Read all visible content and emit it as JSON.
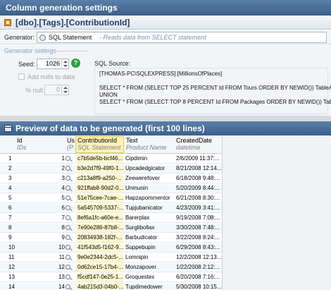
{
  "window_title": "Column generation settings",
  "column_path": "[dbo].[Tags].[ContributionId]",
  "generator": {
    "label": "Generator:",
    "name": "SQL Statement",
    "description": "- Reads data from SELECT statement"
  },
  "settings": {
    "section_title": "Generator settings",
    "seed_label": "Seed:",
    "seed_value": "1026",
    "add_nulls_label": "Add nulls to data",
    "null_pct_label": "% null:",
    "null_pct_value": "0",
    "sql_source_label": "SQL Source:",
    "sql_lines": [
      "[THOMAS-PC\\SQLEXPRESS].[MillionsOfPlaces]",
      "",
      "SELECT * FROM (SELECT TOP 25 PERCENT Id FROM Tours ORDER BY NEWID()) TableA",
      "UNION",
      "SELECT * FROM (SELECT TOP 8 PERCENT Id FROM Packages ORDER BY NEWID()) TableB;"
    ]
  },
  "preview": {
    "title": "Preview of data to be generated (first 100 lines)",
    "columns": [
      {
        "name": "Id",
        "type": "IDs"
      },
      {
        "name": "Us",
        "type": "(P"
      },
      {
        "name": "ContributionId",
        "type": "SQL Statement"
      },
      {
        "name": "Text",
        "type": "Product Name"
      },
      {
        "name": "CreatedDate",
        "type": "datetime"
      }
    ],
    "rows": [
      {
        "rn": "1",
        "id": "1",
        "ci": "c7b5de5b-bcf46...",
        "text": "Cipdimin",
        "date": "2/6/2009 11:37:..."
      },
      {
        "rn": "2",
        "id": "2",
        "ci": "b3e2d7f9-49f0-1...",
        "text": "Upcadedgicator",
        "date": "8/21/2008 12:14..."
      },
      {
        "rn": "3",
        "id": "3",
        "ci": "c213a8f9-a250-...",
        "text": "Zeewerefover",
        "date": "6/18/2008 9:48:..."
      },
      {
        "rn": "4",
        "id": "4",
        "ci": "921ffab8-90d2-0...",
        "text": "Unmunin",
        "date": "5/20/2009 8:44:..."
      },
      {
        "rn": "5",
        "id": "5",
        "ci": "51e75cee-7cae-...",
        "text": "Hapzapommentor",
        "date": "6/21/2008 8:30:..."
      },
      {
        "rn": "6",
        "id": "6",
        "ci": "5a545709-5337-...",
        "text": "Tupjubanicator",
        "date": "4/23/2009 3:41:..."
      },
      {
        "rn": "7",
        "id": "7",
        "ci": "8ef6a1fc-a60e-e...",
        "text": "Barerplax",
        "date": "9/19/2008 7:08:..."
      },
      {
        "rn": "8",
        "id": "8",
        "ci": "7e90e286-87b8-...",
        "text": "Surglibollax",
        "date": "3/30/2008 7:48:..."
      },
      {
        "rn": "9",
        "id": "9",
        "ci": "20834938-182f-...",
        "text": "Barbudicator",
        "date": "3/22/2008 8:24:..."
      },
      {
        "rn": "10",
        "id": "10",
        "ci": "41f543d5-f162-9...",
        "text": "Suppebupin",
        "date": "6/29/2008 8:43:..."
      },
      {
        "rn": "11",
        "id": "11",
        "ci": "9e0e2344-2dc5-...",
        "text": "Lomnipin",
        "date": "12/2/2008 12:13..."
      },
      {
        "rn": "12",
        "id": "12",
        "ci": "0d62ce15-17b4-...",
        "text": "Monzapover",
        "date": "1/22/2008 2:12:..."
      },
      {
        "rn": "13",
        "id": "13",
        "ci": "f5cdf147-0e25-1...",
        "text": "Groquestex",
        "date": "6/20/2008 7:16:..."
      },
      {
        "rn": "14",
        "id": "14",
        "ci": "4ab215d3-04b0-...",
        "text": "Tupdimedower",
        "date": "5/30/2008 10:15..."
      }
    ]
  }
}
